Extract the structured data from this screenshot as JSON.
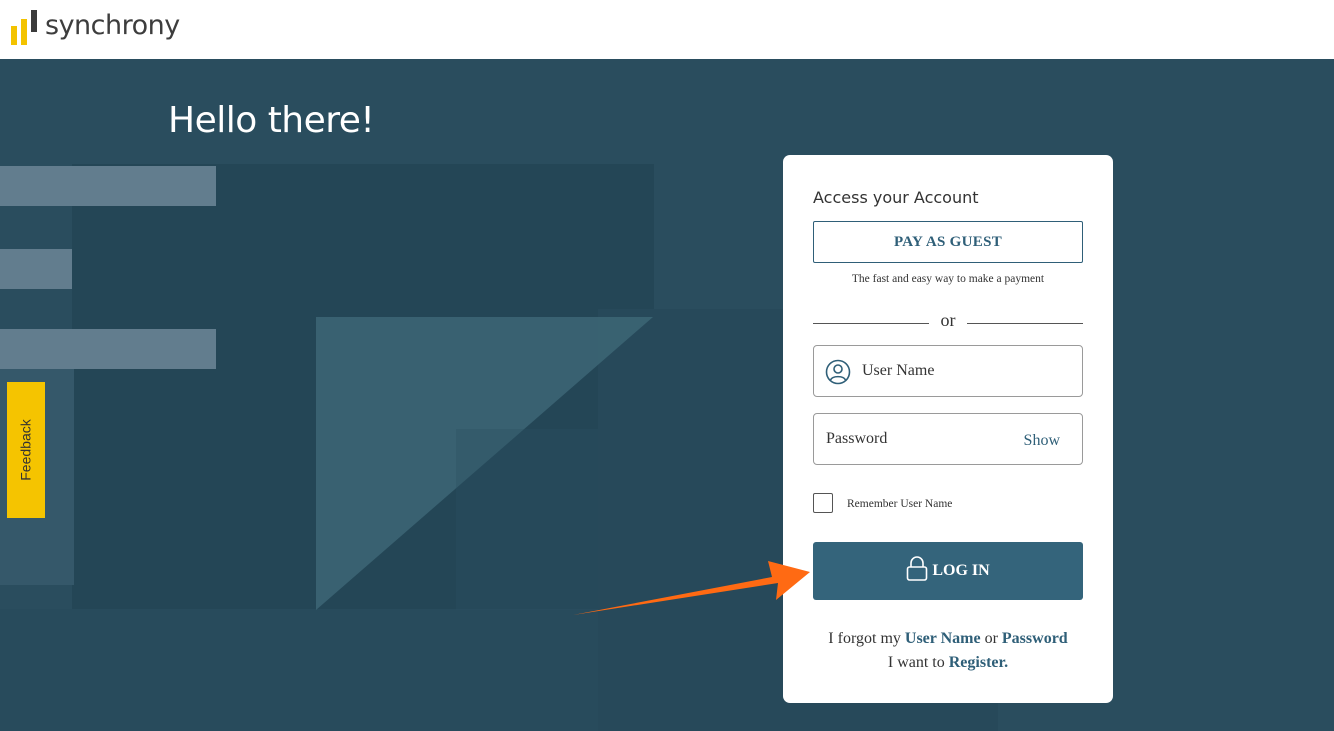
{
  "brand": {
    "name": "synchrony"
  },
  "hero": {
    "greeting": "Hello there!"
  },
  "feedback": {
    "label": "Feedback"
  },
  "login_card": {
    "title": "Access your Account",
    "guest_button": "PAY AS GUEST",
    "guest_subtitle": "The fast and easy way to make a payment",
    "divider_text": "or",
    "username_placeholder": "User Name",
    "password_placeholder": "Password",
    "show_label": "Show",
    "remember_label": "Remember User Name",
    "remember_checked": false,
    "login_button": "LOG IN",
    "forgot_prefix": "I forgot my",
    "forgot_username": "User Name",
    "forgot_or": "or",
    "forgot_password": "Password",
    "register_prefix": "I want to",
    "register_link": "Register."
  },
  "colors": {
    "brand_yellow": "#f3c300",
    "hero_bg": "#2a4d5e",
    "primary": "#34647b",
    "annotation_arrow": "#ff6a13"
  },
  "icons": [
    "user-circle-icon",
    "lock-icon",
    "annotation-arrow"
  ]
}
